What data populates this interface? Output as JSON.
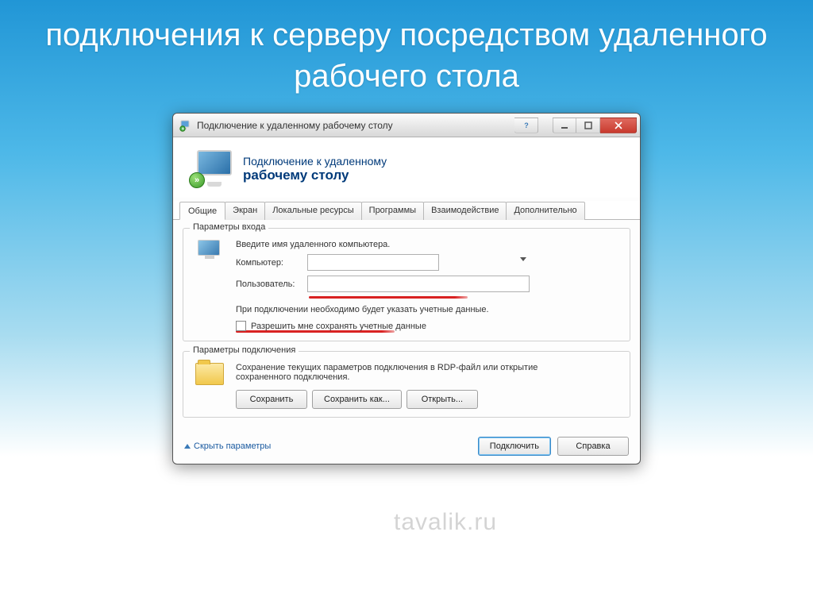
{
  "slide_title": "подключения к серверу посредством удаленного рабочего стола",
  "window": {
    "title": "Подключение к удаленному рабочему столу",
    "header_line1": "Подключение к удаленному",
    "header_line2": "рабочему столу"
  },
  "tabs": [
    "Общие",
    "Экран",
    "Локальные ресурсы",
    "Программы",
    "Взаимодействие",
    "Дополнительно"
  ],
  "login_group": {
    "legend": "Параметры входа",
    "intro": "Введите имя удаленного компьютера.",
    "computer_label": "Компьютер:",
    "computer_value": "",
    "user_label": "Пользователь:",
    "user_value": "",
    "hint": "При подключении необходимо будет указать учетные данные.",
    "checkbox_label": "Разрешить мне сохранять учетные данные"
  },
  "conn_group": {
    "legend": "Параметры подключения",
    "text": "Сохранение текущих параметров подключения в RDP-файл или открытие сохраненного подключения.",
    "save": "Сохранить",
    "save_as": "Сохранить как...",
    "open": "Открыть..."
  },
  "footer": {
    "hide": "Скрыть параметры",
    "connect": "Подключить",
    "help": "Справка"
  },
  "watermark": "tavalik.ru"
}
